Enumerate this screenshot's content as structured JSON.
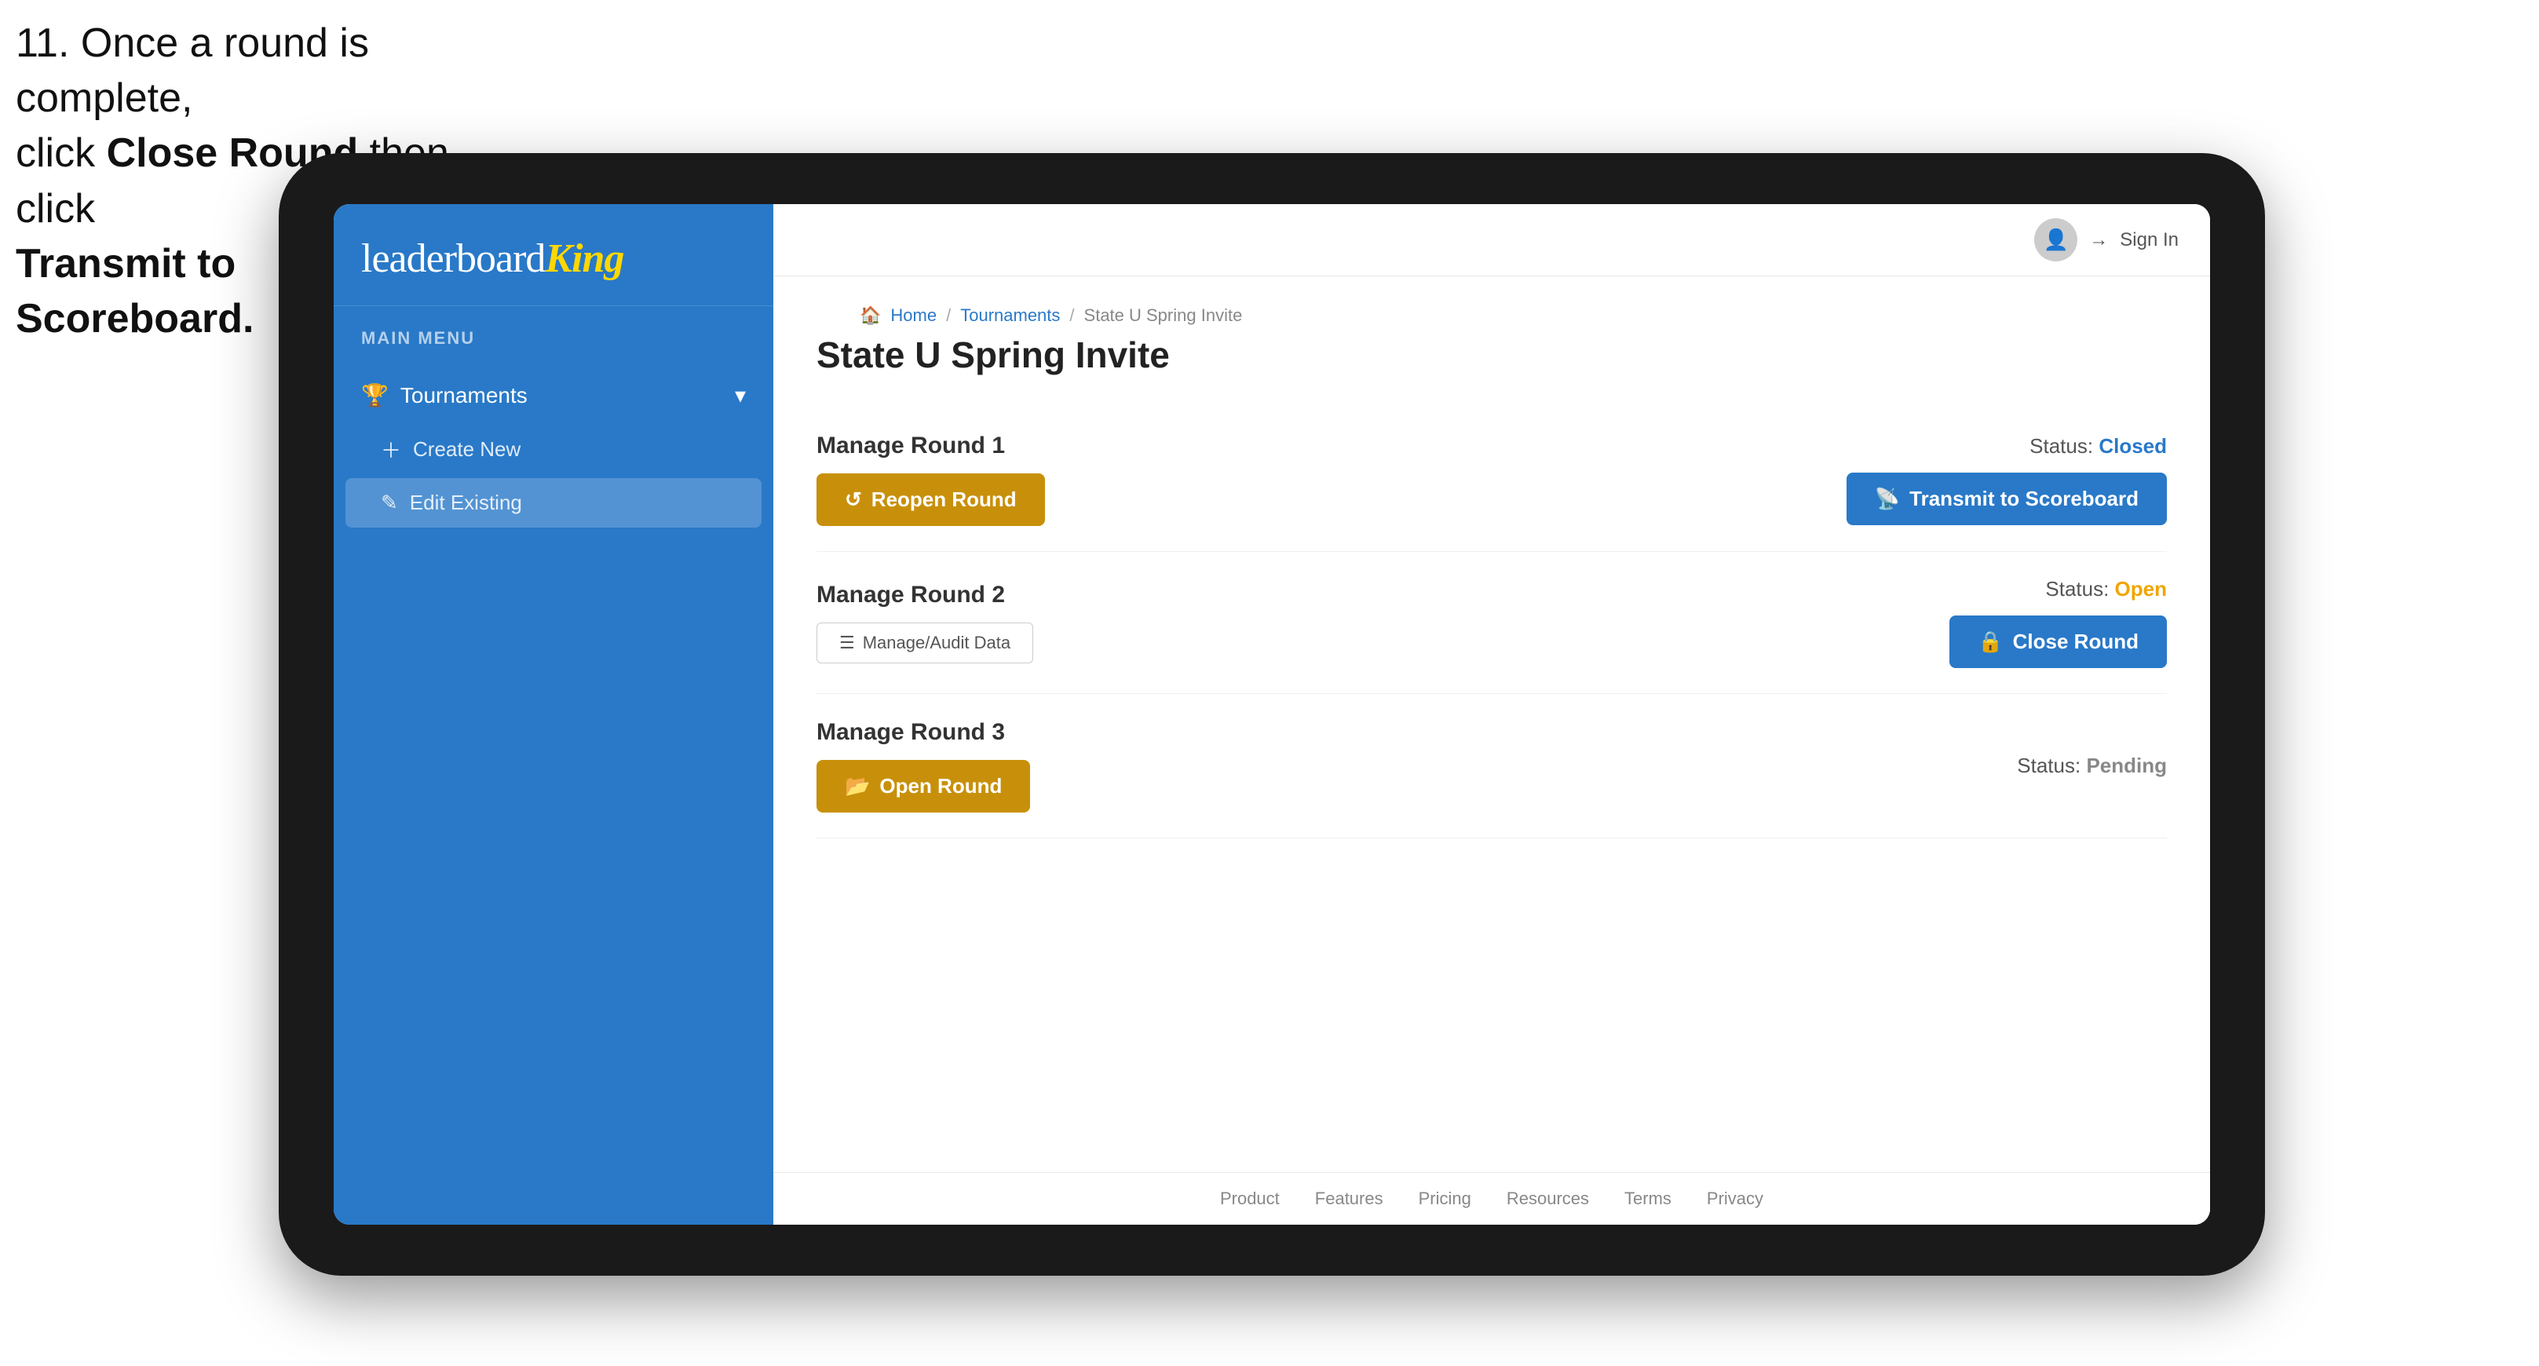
{
  "instruction": {
    "line1": "11. Once a round is complete,",
    "line2": "click ",
    "bold1": "Close Round",
    "line3": " then click",
    "bold2": "Transmit to Scoreboard."
  },
  "logo": {
    "leaderboard": "leaderboard",
    "king": "King"
  },
  "sidebar": {
    "main_menu_label": "MAIN MENU",
    "nav_items": [
      {
        "label": "Tournaments",
        "has_arrow": true
      }
    ],
    "sub_items": [
      {
        "label": "Create New",
        "icon": "plus"
      },
      {
        "label": "Edit Existing",
        "icon": "edit",
        "selected": true
      }
    ]
  },
  "topbar": {
    "sign_in_label": "Sign In"
  },
  "breadcrumb": {
    "home": "Home",
    "sep1": "/",
    "tournaments": "Tournaments",
    "sep2": "/",
    "current": "State U Spring Invite"
  },
  "page": {
    "title": "State U Spring Invite",
    "rounds": [
      {
        "label": "Manage Round 1",
        "status_label": "Status:",
        "status_value": "Closed",
        "status_class": "status-closed",
        "button1_label": "Reopen Round",
        "button1_type": "gold",
        "button2_label": "Transmit to Scoreboard",
        "button2_type": "blue"
      },
      {
        "label": "Manage Round 2",
        "status_label": "Status:",
        "status_value": "Open",
        "status_class": "status-open",
        "button1_label": "Manage/Audit Data",
        "button1_type": "outlined",
        "button2_label": "Close Round",
        "button2_type": "blue"
      },
      {
        "label": "Manage Round 3",
        "status_label": "Status:",
        "status_value": "Pending",
        "status_class": "status-pending",
        "button1_label": "Open Round",
        "button1_type": "gold"
      }
    ]
  },
  "footer": {
    "links": [
      "Product",
      "Features",
      "Pricing",
      "Resources",
      "Terms",
      "Privacy"
    ]
  }
}
